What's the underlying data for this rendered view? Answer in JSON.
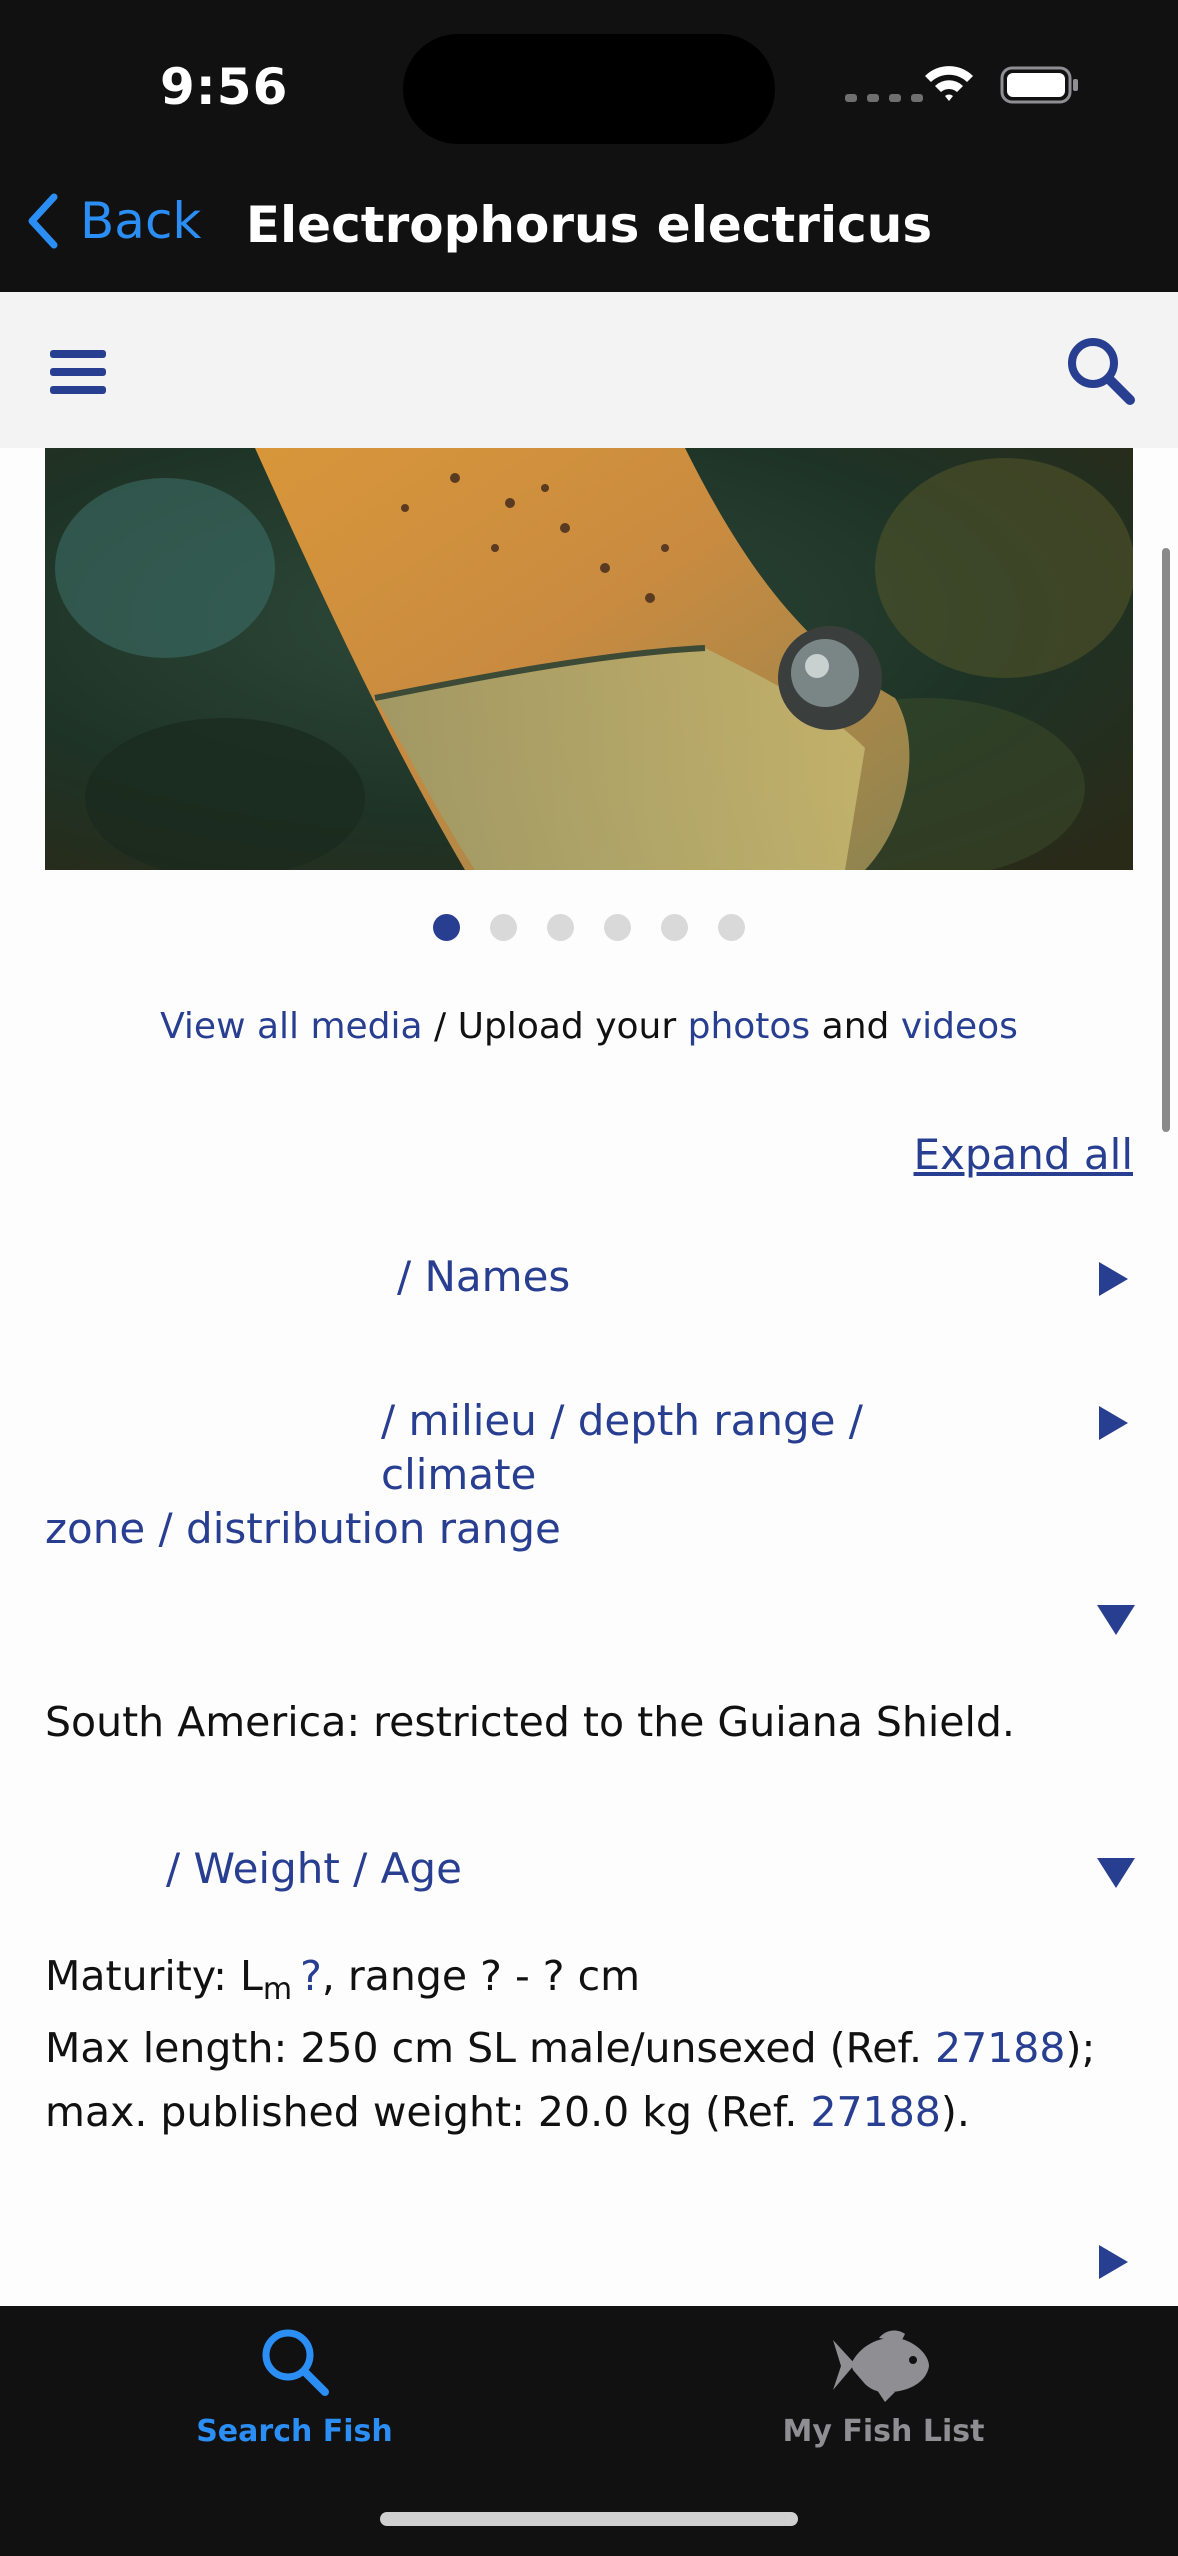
{
  "status_bar": {
    "time": "9:56"
  },
  "nav": {
    "back_label": "Back",
    "title": "Electrophorus electricus"
  },
  "gallery": {
    "image_count": 6,
    "active_index": 0
  },
  "media_links": {
    "view_all": "View all media",
    "separator": " / Upload your ",
    "photos": "photos",
    "and": " and ",
    "videos": "videos"
  },
  "expand_all": "Expand all",
  "sections": {
    "names": {
      "title": "/ Names"
    },
    "environment": {
      "title_line1": "/ milieu / depth range / climate",
      "title_line2": "zone / distribution range"
    },
    "distribution": {
      "text": "South America: restricted to the Guiana Shield."
    },
    "size": {
      "title": "/ Weight / Age",
      "maturity_prefix": "Maturity: L",
      "maturity_sub": "m",
      "maturity_link": "?",
      "maturity_suffix": ", range ? - ? cm",
      "max_prefix": "Max length: 250 cm SL male/unsexed (Ref. ",
      "ref1": "27188",
      "max_middle": "); max. published weight: 20.0 kg (Ref. ",
      "ref2": "27188",
      "max_suffix": ")."
    }
  },
  "tabbar": {
    "tabs": [
      {
        "label": "Search Fish",
        "icon": "search-icon",
        "active": true,
        "color": "#2b8ef5"
      },
      {
        "label": "My Fish List",
        "icon": "fish-icon",
        "active": false,
        "color": "#8e8e93"
      }
    ]
  },
  "colors": {
    "accent": "#283e91",
    "ios_blue": "#2b8ef5",
    "bar_bg": "#111111"
  }
}
